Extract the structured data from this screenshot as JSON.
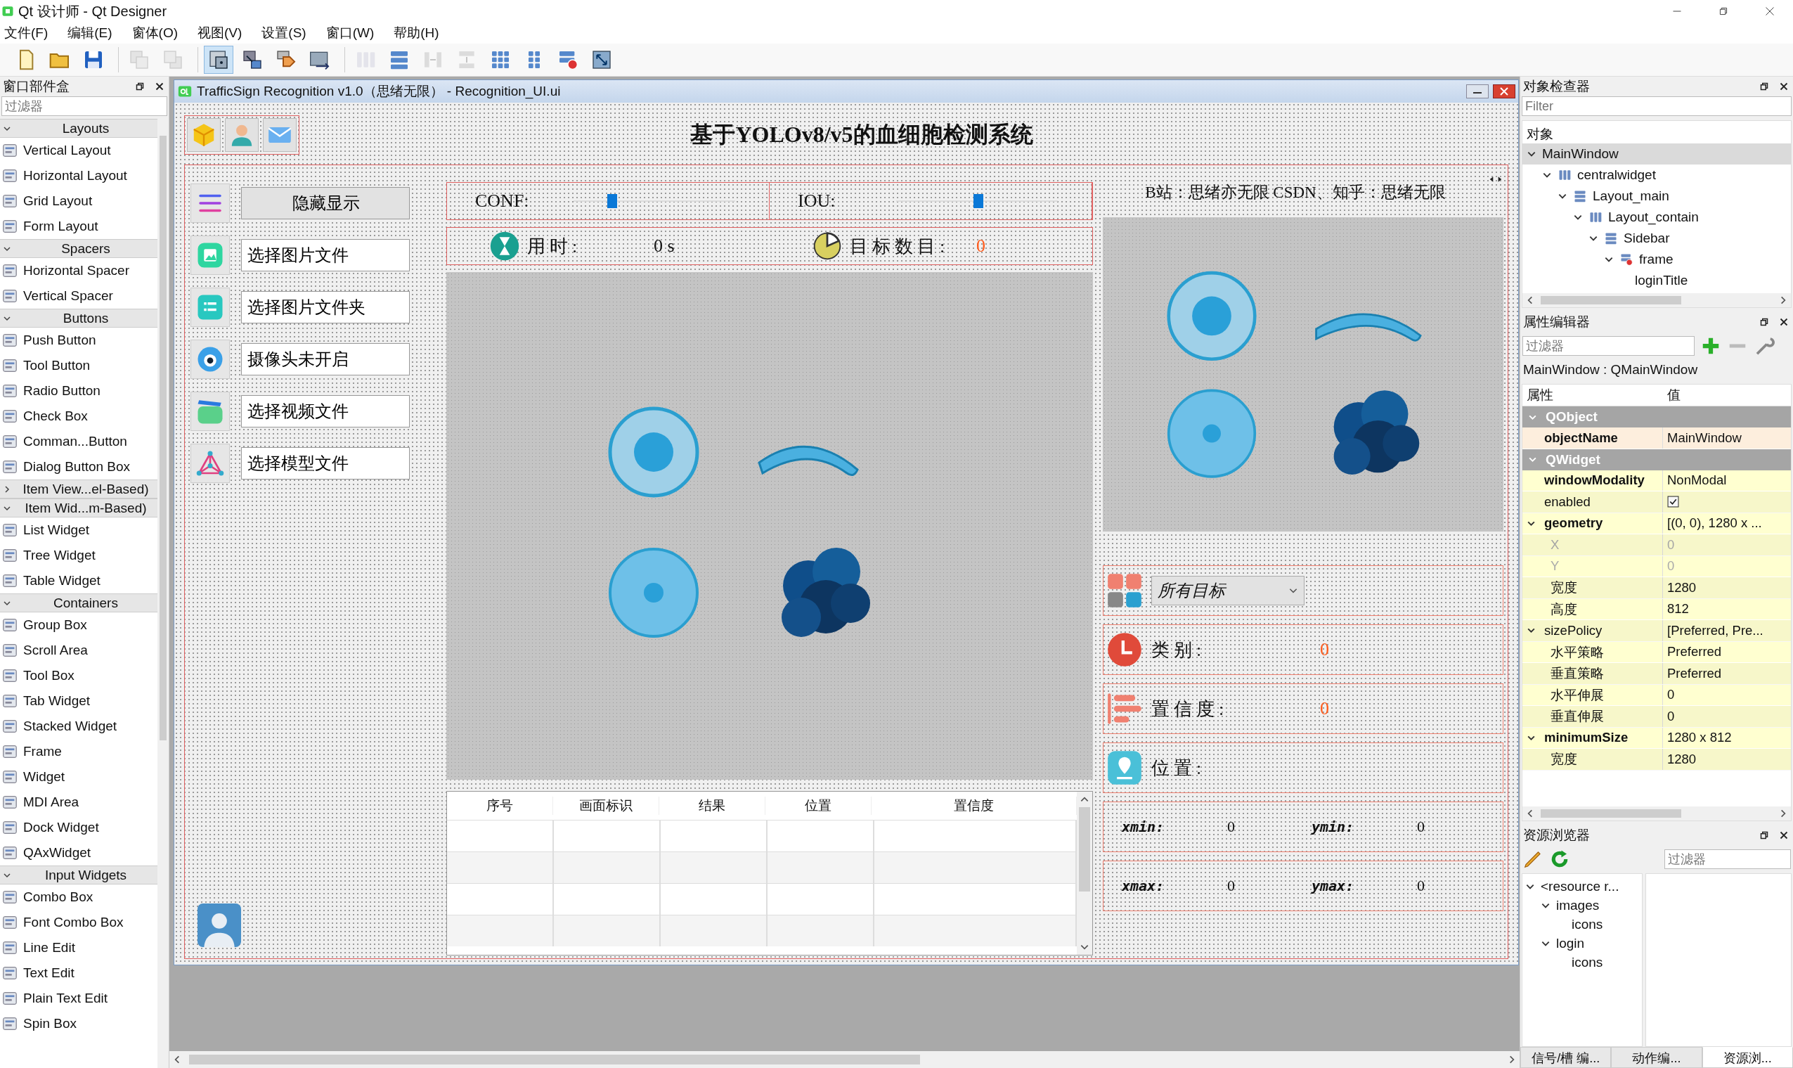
{
  "app_title": "Qt 设计师 - Qt Designer",
  "menu": [
    "文件(F)",
    "编辑(E)",
    "窗体(O)",
    "视图(V)",
    "设置(S)",
    "窗口(W)",
    "帮助(H)"
  ],
  "toolbar_groups": [
    {
      "items": [
        {
          "kind": "new",
          "selected": false,
          "disabled": false
        },
        {
          "kind": "open",
          "selected": false,
          "disabled": false
        },
        {
          "kind": "save",
          "selected": false,
          "disabled": false
        }
      ]
    },
    {
      "items": [
        {
          "kind": "lower",
          "selected": false,
          "disabled": true
        },
        {
          "kind": "raise",
          "selected": false,
          "disabled": true
        }
      ]
    },
    {
      "items": [
        {
          "kind": "widgets",
          "selected": true,
          "disabled": false
        },
        {
          "kind": "signals",
          "selected": false,
          "disabled": false
        },
        {
          "kind": "buddies",
          "selected": false,
          "disabled": false
        },
        {
          "kind": "taborder",
          "selected": false,
          "disabled": false
        }
      ]
    },
    {
      "items": [
        {
          "kind": "hlayout",
          "selected": false,
          "disabled": true
        },
        {
          "kind": "vlayout",
          "selected": false,
          "disabled": false
        },
        {
          "kind": "hsplit",
          "selected": false,
          "disabled": true
        },
        {
          "kind": "vsplit",
          "selected": false,
          "disabled": true
        },
        {
          "kind": "grid",
          "selected": false,
          "disabled": false
        },
        {
          "kind": "form",
          "selected": false,
          "disabled": false
        },
        {
          "kind": "break",
          "selected": false,
          "disabled": false
        },
        {
          "kind": "adjust",
          "selected": false,
          "disabled": false
        }
      ]
    }
  ],
  "widget_box": {
    "title": "窗口部件盒",
    "filter_placeholder": "过滤器",
    "categories": [
      {
        "label": "Layouts",
        "expanded": true,
        "items": [
          "Vertical Layout",
          "Horizontal Layout",
          "Grid Layout",
          "Form Layout"
        ]
      },
      {
        "label": "Spacers",
        "expanded": true,
        "items": [
          "Horizontal Spacer",
          "Vertical Spacer"
        ]
      },
      {
        "label": "Buttons",
        "expanded": true,
        "items": [
          "Push Button",
          "Tool Button",
          "Radio Button",
          "Check Box",
          "Comman...Button",
          "Dialog Button Box"
        ]
      },
      {
        "label": "Item View...el-Based)",
        "expanded": false
      },
      {
        "label": "Item Wid...m-Based)",
        "expanded": true,
        "items": [
          "List Widget",
          "Tree Widget",
          "Table Widget"
        ]
      },
      {
        "label": "Containers",
        "expanded": true,
        "items": [
          "Group Box",
          "Scroll Area",
          "Tool Box",
          "Tab Widget",
          "Stacked Widget",
          "Frame",
          "Widget",
          "MDI Area",
          "Dock Widget",
          "QAxWidget"
        ]
      },
      {
        "label": "Input Widgets",
        "expanded": true,
        "items": [
          "Combo Box",
          "Font Combo Box",
          "Line Edit",
          "Text Edit",
          "Plain Text Edit",
          "Spin Box"
        ]
      }
    ]
  },
  "form": {
    "title": "TrafficSign Recognition v1.0（思绪无限） - Recognition_UI.ui",
    "header_icons": [
      {
        "kind": "cube"
      },
      {
        "kind": "person"
      },
      {
        "kind": "mail"
      }
    ],
    "heading": "基于YOLOv8/v5的血细胞检测系统",
    "sidebar": [
      {
        "kind": "menu",
        "label": "隐藏显示"
      },
      {
        "kind": "image",
        "label": "选择图片文件"
      },
      {
        "kind": "folder",
        "label": "选择图片文件夹"
      },
      {
        "kind": "camera",
        "label": "摄像头未开启"
      },
      {
        "kind": "video",
        "label": "选择视频文件"
      },
      {
        "kind": "model",
        "label": "选择模型文件"
      }
    ],
    "sliders": [
      {
        "label": "CONF:",
        "level": 0.24
      },
      {
        "label": "IOU:",
        "level": 0.51
      }
    ],
    "stats": [
      {
        "kind": "time",
        "label": "用时:",
        "value": "0 s"
      },
      {
        "kind": "count",
        "label": "目标数目:",
        "value": "0"
      }
    ],
    "table": {
      "columns": [
        "序号",
        "画面标识",
        "结果",
        "位置",
        "置信度"
      ]
    },
    "credit": "B站：思绪亦无限  CSDN、知乎：思绪无限",
    "combo": {
      "value": "所有目标"
    },
    "fields": [
      {
        "kind": "class",
        "label": "类别:",
        "value": "0"
      },
      {
        "kind": "confidence",
        "label": "置信度:",
        "value": "0"
      },
      {
        "kind": "location",
        "label": "位置:"
      }
    ],
    "coords": [
      {
        "label": "xmin:",
        "value": "0"
      },
      {
        "label": "ymin:",
        "value": "0"
      },
      {
        "label": "xmax:",
        "value": "0"
      },
      {
        "label": "ymax:",
        "value": "0"
      }
    ]
  },
  "object_inspector": {
    "title": "对象检查器",
    "filter_placeholder": "Filter",
    "header": "对象",
    "tree": [
      {
        "name": "MainWindow",
        "selected": true,
        "expanded": true,
        "children": [
          {
            "name": "centralwidget",
            "kind": "hbox",
            "selected": false,
            "expanded": true,
            "children": [
              {
                "name": "Layout_main",
                "kind": "vbox",
                "selected": false,
                "expanded": true,
                "children": [
                  {
                    "name": "Layout_contain",
                    "kind": "hbox",
                    "selected": false,
                    "expanded": true,
                    "children": [
                      {
                        "name": "Sidebar",
                        "kind": "vbox",
                        "selected": false,
                        "expanded": true,
                        "children": [
                          {
                            "name": "frame",
                            "kind": "frame",
                            "selected": false,
                            "expanded": true,
                            "children": [
                              {
                                "name": "loginTitle",
                                "selected": false
                              }
                            ]
                          }
                        ]
                      }
                    ]
                  }
                ]
              }
            ]
          }
        ]
      }
    ]
  },
  "property_editor": {
    "title": "属性编辑器",
    "filter_placeholder": "过滤器",
    "object": "MainWindow : QMainWindow",
    "headers": [
      "属性",
      "值"
    ],
    "groups": [
      {
        "name": "QObject",
        "expanded": true,
        "props": [
          {
            "kind": "text",
            "name": "objectName",
            "value": "MainWindow",
            "changed": true
          }
        ]
      },
      {
        "name": "QWidget",
        "expanded": true,
        "props": [
          {
            "kind": "text",
            "name": "windowModality",
            "value": "NonModal",
            "changed": true
          },
          {
            "kind": "check",
            "name": "enabled",
            "checked": true,
            "changed": false
          },
          {
            "kind": "text",
            "name": "geometry",
            "value": "[(0, 0), 1280 x ...",
            "changed": true,
            "expanded": true,
            "children": [
              {
                "name": "X",
                "value": "0",
                "disabled": true
              },
              {
                "name": "Y",
                "value": "0",
                "disabled": true
              },
              {
                "name": "宽度",
                "value": "1280",
                "disabled": false
              },
              {
                "name": "高度",
                "value": "812",
                "disabled": false
              }
            ]
          },
          {
            "kind": "text",
            "name": "sizePolicy",
            "value": "[Preferred, Pre...",
            "changed": false,
            "expanded": true,
            "children": [
              {
                "name": "水平策略",
                "value": "Preferred",
                "disabled": false
              },
              {
                "name": "垂直策略",
                "value": "Preferred",
                "disabled": false
              },
              {
                "name": "水平伸展",
                "value": "0",
                "disabled": false
              },
              {
                "name": "垂直伸展",
                "value": "0",
                "disabled": false
              }
            ]
          },
          {
            "kind": "text",
            "name": "minimumSize",
            "value": "1280 x 812",
            "changed": true,
            "expanded": true,
            "children": [
              {
                "name": "宽度",
                "value": "1280",
                "disabled": false
              }
            ]
          }
        ]
      }
    ]
  },
  "resource_browser": {
    "title": "资源浏览器",
    "filter_placeholder": "过滤器",
    "tree": [
      {
        "name": "<resource r...",
        "expanded": true,
        "children": [
          {
            "name": "images",
            "expanded": true,
            "children": [
              {
                "name": "icons"
              }
            ]
          },
          {
            "name": "login",
            "expanded": true,
            "children": [
              {
                "name": "icons"
              }
            ]
          }
        ]
      }
    ]
  },
  "bottom_tabs": [
    {
      "label": "信号/槽 编...",
      "selected": false
    },
    {
      "label": "动作编...",
      "selected": false
    },
    {
      "label": "资源浏...",
      "selected": true
    }
  ]
}
